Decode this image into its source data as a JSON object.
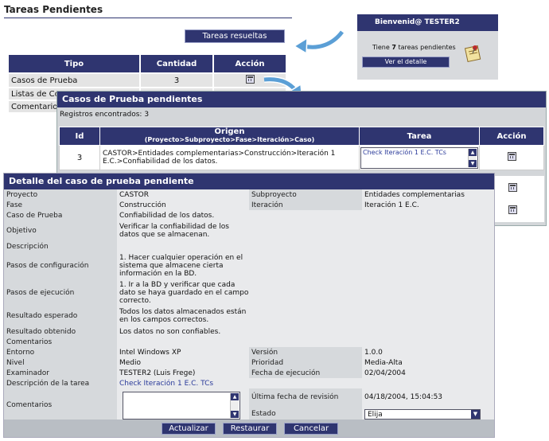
{
  "page": {
    "title": "Tareas Pendientes",
    "resolved_button": "Tareas resueltas"
  },
  "summary": {
    "headers": [
      "Tipo",
      "Cantidad",
      "Acción"
    ],
    "rows": [
      {
        "tipo": "Casos de Prueba",
        "cantidad": "3"
      },
      {
        "tipo": "Listas de Co",
        "cantidad": ""
      },
      {
        "tipo": "Comentarios",
        "cantidad": ""
      }
    ]
  },
  "welcome": {
    "title": "Bienvenid@ TESTER2",
    "pre": "Tiene ",
    "count": "7",
    "post": " tareas pendientes",
    "button": "Ver el detalle"
  },
  "pending": {
    "title": "Casos de Prueba pendientes",
    "records": "Registros encontrados: 3",
    "headers": {
      "id": "Id",
      "origen": "Origen",
      "origen_sub": "(Proyecto>Subproyecto>Fase>Iteración>Caso)",
      "tarea": "Tarea",
      "accion": "Acción"
    },
    "row": {
      "id": "3",
      "origen": "CASTOR>Entidades complementarias>Construcción>Iteración 1 E.C.>Confiabilidad de los datos.",
      "tarea": "Check Iteración 1 E.C. TCs"
    }
  },
  "detail": {
    "title": "Detalle del caso de prueba pendiente",
    "proyecto": {
      "label": "Proyecto",
      "value": "CASTOR"
    },
    "subproyecto": {
      "label": "Subproyecto",
      "value": "Entidades complementarias"
    },
    "fase": {
      "label": "Fase",
      "value": "Construcción"
    },
    "iteracion": {
      "label": "Iteración",
      "value": "Iteración 1 E.C."
    },
    "caso": {
      "label": "Caso de Prueba",
      "value": "Confiabilidad de los datos."
    },
    "objetivo": {
      "label": "Objetivo",
      "value": "Verificar la confiabilidad de los datos que se almacenan."
    },
    "descripcion": {
      "label": "Descripción",
      "value": ""
    },
    "pasos_config": {
      "label": "Pasos de configuración",
      "value": "1. Hacer cualquier operación en el sistema que almacene cierta información en la BD."
    },
    "pasos_ejec": {
      "label": "Pasos de ejecución",
      "value": "1. Ir a la BD y verificar que cada dato se haya guardado en el campo correcto."
    },
    "resultado_esperado": {
      "label": "Resultado esperado",
      "value": "Todos los datos almacenados están en los campos correctos."
    },
    "resultado_obtenido": {
      "label": "Resultado obtenido",
      "value": "Los datos no son confiables."
    },
    "comentarios_row": {
      "label": "Comentarios",
      "value": ""
    },
    "entorno": {
      "label": "Entorno",
      "value": "Intel Windows XP"
    },
    "version": {
      "label": "Versión",
      "value": "1.0.0"
    },
    "nivel": {
      "label": "Nivel",
      "value": "Medio"
    },
    "prioridad": {
      "label": "Prioridad",
      "value": "Media-Alta"
    },
    "examinador": {
      "label": "Examinador",
      "value": "TESTER2 (Luis Frege)"
    },
    "fecha_ejec": {
      "label": "Fecha de ejecución",
      "value": "02/04/2004"
    },
    "desc_tarea": {
      "label": "Descripción de la tarea",
      "value": "Check Iteración 1 E.C. TCs"
    },
    "comentarios": {
      "label": "Comentarios",
      "value": ""
    },
    "ultima_rev": {
      "label": "Última fecha de revisión",
      "value": "04/18/2004, 15:04:53"
    },
    "estado": {
      "label": "Estado",
      "value": "Elija"
    },
    "buttons": {
      "update": "Actualizar",
      "restore": "Restaurar",
      "cancel": "Cancelar"
    }
  }
}
